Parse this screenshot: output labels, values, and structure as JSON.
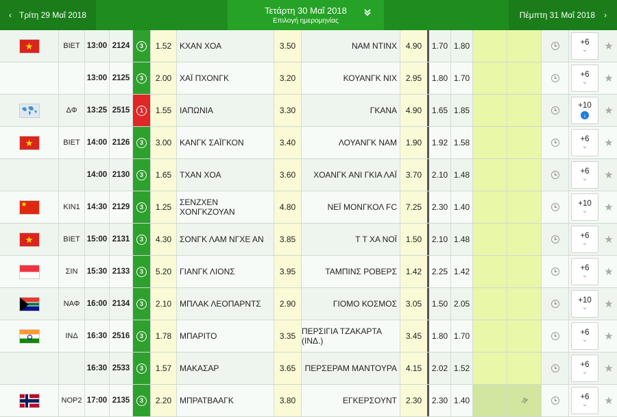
{
  "header": {
    "prev_date": "Τρίτη 29 Μαΐ 2018",
    "current_date": "Τετάρτη 30 Μαΐ 2018",
    "current_sub": "Επιλογή ημερομηνίας",
    "next_date": "Πέμπτη 31 Μαΐ 2018"
  },
  "colors": {
    "header_green": "#1e8a1e",
    "status_green": "#2ea02e",
    "status_red": "#e02626",
    "odds_yellow": "#fafad6",
    "highlight_green": "#e9f7a8"
  },
  "matches": [
    {
      "flag": "vn",
      "league": "ΒΙΕΤ",
      "time": "13:00",
      "code": "2124",
      "minute": "3",
      "minute_red": false,
      "odd1": "1.52",
      "home": "ΚΧΑΝ ΧΟΑ",
      "oddx": "3.50",
      "away": "ΝΑΜ ΝΤΙΝΧ",
      "odd2": "4.90",
      "under": "1.70",
      "over": "1.80",
      "more": "+6",
      "more_icon": "chevron-down"
    },
    {
      "flag": "",
      "league": "",
      "time": "13:00",
      "code": "2125",
      "minute": "3",
      "minute_red": false,
      "odd1": "2.00",
      "home": "ΧΑΪ ΠΧΟΝΓΚ",
      "oddx": "3.20",
      "away": "ΚΟΥΑΝΓΚ ΝΙΧ",
      "odd2": "2.95",
      "under": "1.80",
      "over": "1.70",
      "more": "+6",
      "more_icon": "chevron-down"
    },
    {
      "flag": "world",
      "league": "ΔΦ",
      "time": "13:25",
      "code": "2515",
      "minute": "1",
      "minute_red": true,
      "odd1": "1.55",
      "home": "ΙΑΠΩΝΙΑ",
      "oddx": "3.30",
      "away": "ΓΚΑΝΑ",
      "odd2": "4.90",
      "under": "1.65",
      "over": "1.85",
      "more": "+10",
      "more_icon": "down-circle"
    },
    {
      "flag": "vn",
      "league": "ΒΙΕΤ",
      "time": "14:00",
      "code": "2126",
      "minute": "3",
      "minute_red": false,
      "odd1": "3.00",
      "home": "ΚΑΝΓΚ ΣΑΪΓΚΟΝ",
      "oddx": "3.40",
      "away": "ΛΟΥΑΝΓΚ ΝΑΜ",
      "odd2": "1.90",
      "under": "1.92",
      "over": "1.58",
      "more": "+6",
      "more_icon": "chevron-down"
    },
    {
      "flag": "",
      "league": "",
      "time": "14:00",
      "code": "2130",
      "minute": "3",
      "minute_red": false,
      "odd1": "1.65",
      "home": "ΤΧΑΝ ΧΟΑ",
      "oddx": "3.60",
      "away": "ΧΟΑΝΓΚ ΑΝΙ ΓΚΙΑ ΛΑΪ",
      "odd2": "3.70",
      "under": "2.10",
      "over": "1.48",
      "more": "+6",
      "more_icon": "chevron-down"
    },
    {
      "flag": "cn",
      "league": "ΚΙΝ1",
      "time": "14:30",
      "code": "2129",
      "minute": "3",
      "minute_red": false,
      "odd1": "1.25",
      "home": "ΣΕΝΖΧΕΝ ΧΟΝΓΚΖΟΥΑΝ",
      "oddx": "4.80",
      "away": "ΝΕΪ ΜΟΝΓΚΟΛ FC",
      "odd2": "7.25",
      "under": "2.30",
      "over": "1.40",
      "more": "+10",
      "more_icon": "chevron-down"
    },
    {
      "flag": "vn",
      "league": "ΒΙΕΤ",
      "time": "15:00",
      "code": "2131",
      "minute": "3",
      "minute_red": false,
      "odd1": "4.30",
      "home": "ΣΟΝΓΚ ΛΑΜ ΝΓΧΕ ΑΝ",
      "oddx": "3.85",
      "away": "Τ Τ ΧΑ ΝΟΪ",
      "odd2": "1.50",
      "under": "2.10",
      "over": "1.48",
      "more": "+6",
      "more_icon": "chevron-down"
    },
    {
      "flag": "sg",
      "league": "ΣΙΝ",
      "time": "15:30",
      "code": "2133",
      "minute": "3",
      "minute_red": false,
      "odd1": "5.20",
      "home": "ΓΙΑΝΓΚ ΛΙΟΝΣ",
      "oddx": "3.95",
      "away": "ΤΑΜΠΙΝΣ ΡΟΒΕΡΣ",
      "odd2": "1.42",
      "under": "2.25",
      "over": "1.42",
      "more": "+6",
      "more_icon": "chevron-down"
    },
    {
      "flag": "za",
      "league": "ΝΑΦ",
      "time": "16:00",
      "code": "2134",
      "minute": "3",
      "minute_red": false,
      "odd1": "2.10",
      "home": "ΜΠΛΑΚ ΛΕΟΠΑΡΝΤΣ",
      "oddx": "2.90",
      "away": "ΓΙΟΜΟ ΚΟΣΜΟΣ",
      "odd2": "3.05",
      "under": "1.50",
      "over": "2.05",
      "more": "+10",
      "more_icon": "chevron-down"
    },
    {
      "flag": "in",
      "league": "ΙΝΔ",
      "time": "16:30",
      "code": "2516",
      "minute": "3",
      "minute_red": false,
      "odd1": "1.78",
      "home": "ΜΠΑΡΙΤΟ",
      "oddx": "3.35",
      "away": "ΠΕΡΣΙΓΙΑ ΤΖΑΚΑΡΤΑ (ΙΝΔ.)",
      "odd2": "3.45",
      "under": "1.80",
      "over": "1.70",
      "more": "+6",
      "more_icon": "chevron-down"
    },
    {
      "flag": "",
      "league": "",
      "time": "16:30",
      "code": "2533",
      "minute": "3",
      "minute_red": false,
      "odd1": "1.57",
      "home": "ΜΑΚΑΣΑΡ",
      "oddx": "3.65",
      "away": "ΠΕΡΣΕΡΑΜ ΜΑΝΤΟΥΡΑ",
      "odd2": "4.15",
      "under": "2.02",
      "over": "1.52",
      "more": "+6",
      "more_icon": "chevron-down"
    },
    {
      "flag": "no",
      "league": "ΝΟΡ2",
      "time": "17:00",
      "code": "2135",
      "minute": "3",
      "minute_red": false,
      "odd1": "2.20",
      "home": "ΜΠΡΑΤΒΑΑΓΚ",
      "oddx": "3.80",
      "away": "ΕΓΚΕΡΣΟΥΝΤ",
      "odd2": "2.30",
      "under": "2.30",
      "over": "1.40",
      "more": "+6",
      "more_icon": "chevron-down",
      "selected": true
    }
  ]
}
